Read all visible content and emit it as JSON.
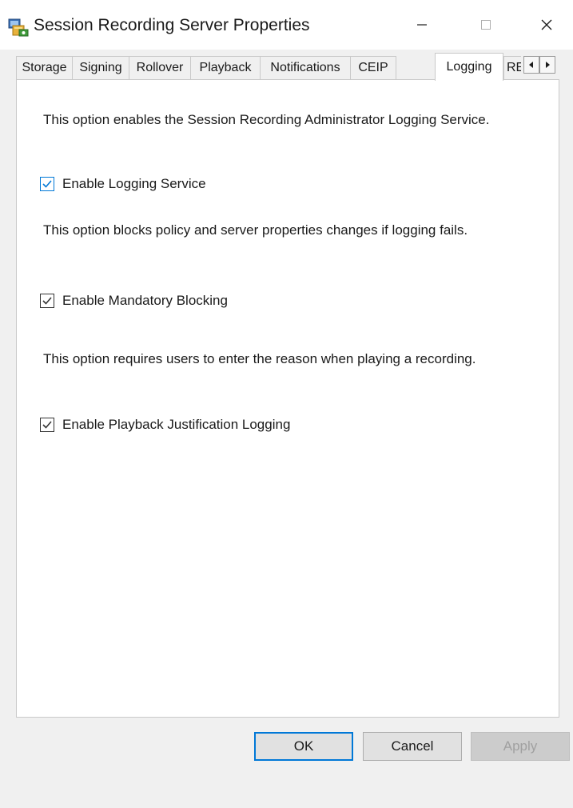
{
  "window": {
    "title": "Session Recording Server Properties",
    "icon": "session-recording-app-icon",
    "controls": {
      "minimize": "minimize-icon",
      "maximize": "maximize-icon",
      "close": "close-icon"
    }
  },
  "tabs": [
    {
      "label": "Storage",
      "active": false
    },
    {
      "label": "Signing",
      "active": false
    },
    {
      "label": "Rollover",
      "active": false
    },
    {
      "label": "Playback",
      "active": false
    },
    {
      "label": "Notifications",
      "active": false
    },
    {
      "label": "CEIP",
      "active": false
    },
    {
      "label": "Logging",
      "active": true
    },
    {
      "label": "RE",
      "active": false
    }
  ],
  "tab_scroll": {
    "left": "chevron-left-icon",
    "right": "chevron-right-icon"
  },
  "logging": {
    "logging_service_desc": "This option enables the Session Recording Administrator Logging Service.",
    "logging_service_label": "Enable Logging Service",
    "logging_service_checked": true,
    "mandatory_blocking_desc": "This option blocks policy and server properties changes if logging fails.",
    "mandatory_blocking_label": "Enable Mandatory Blocking",
    "mandatory_blocking_checked": true,
    "playback_justification_desc": "This option requires users to enter the reason when playing a recording.",
    "playback_justification_label": "Enable Playback Justification Logging",
    "playback_justification_checked": true
  },
  "buttons": {
    "ok": "OK",
    "cancel": "Cancel",
    "apply": "Apply"
  },
  "colors": {
    "accent": "#0078d7",
    "panel_bg": "#ffffff",
    "window_bg": "#f0f0f0"
  }
}
